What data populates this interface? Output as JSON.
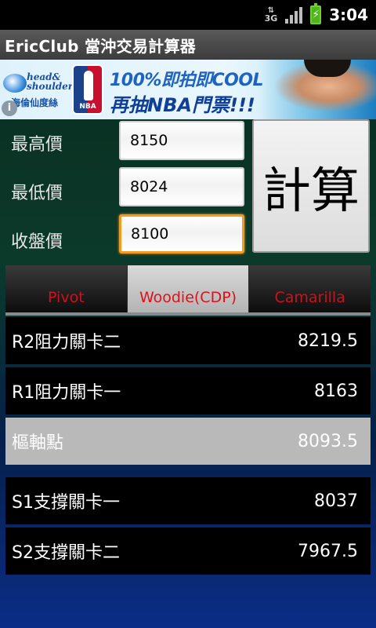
{
  "status_bar": {
    "network": "3G",
    "time": "3:04"
  },
  "app": {
    "title": "EricClub 當沖交易計算器"
  },
  "ad": {
    "brand": "head&\nshoulders",
    "brand_sub": "海倫仙度絲",
    "logo": "NBA",
    "headline": "100%即拍即COOL",
    "subline": "再抽NBA門票!!!"
  },
  "form": {
    "high_label": "最高價",
    "high_value": "8150",
    "low_label": "最低價",
    "low_value": "8024",
    "close_label": "收盤價",
    "close_value": "8100",
    "calculate_label": "計算"
  },
  "tabs": [
    {
      "label": "Pivot",
      "selected": false
    },
    {
      "label": "Woodie(CDP)",
      "selected": true
    },
    {
      "label": "Camarilla",
      "selected": false
    }
  ],
  "results": [
    {
      "label": "R2阻力關卡二",
      "value": "8219.5"
    },
    {
      "label": "R1阻力關卡一",
      "value": "8163"
    },
    {
      "label": "樞軸點",
      "value": "8093.5"
    },
    {
      "label": "S1支撐關卡一",
      "value": "8037"
    },
    {
      "label": "S2支撐關卡二",
      "value": "7967.5"
    }
  ],
  "colors": {
    "tab_text": "#d0101c",
    "focus_border": "#f39a1f",
    "highlight_row": "#b9b9b9"
  }
}
